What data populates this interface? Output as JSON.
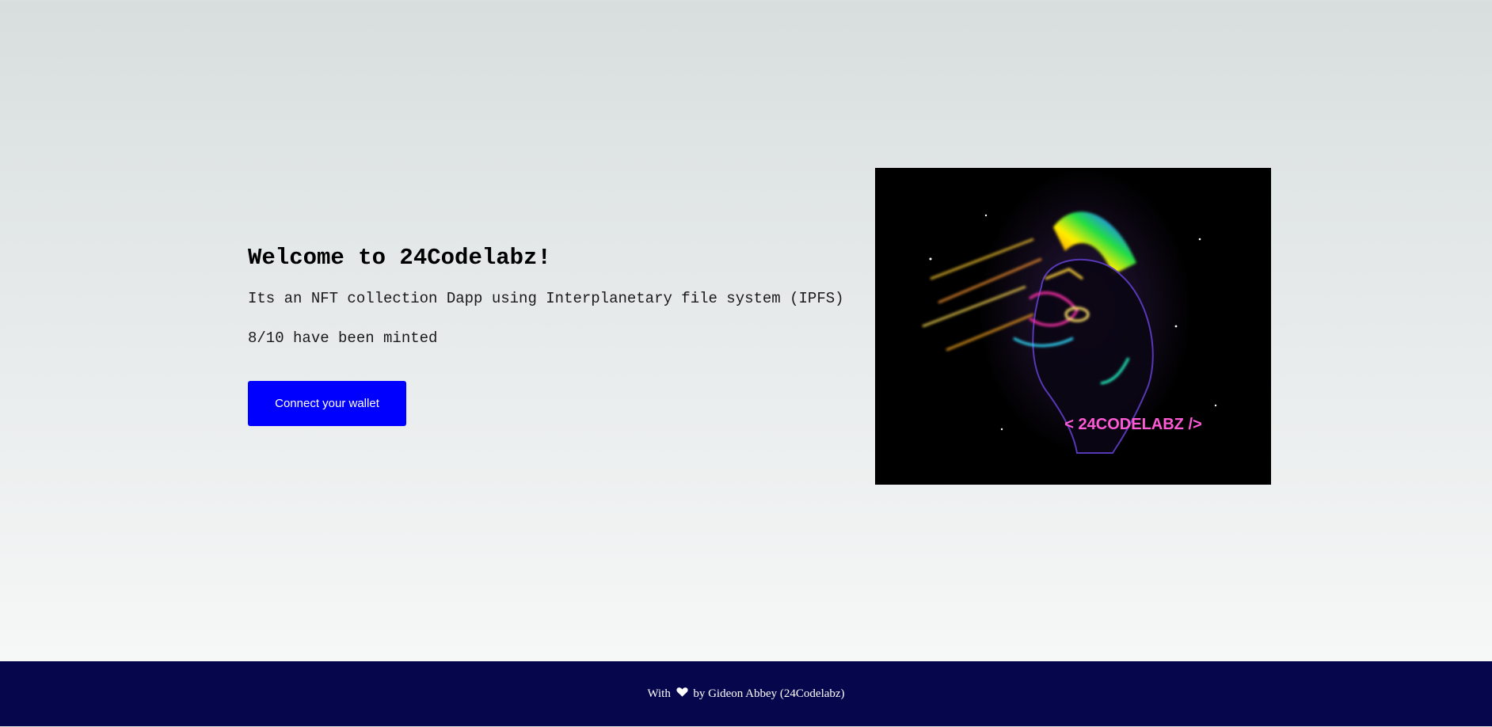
{
  "hero": {
    "title": "Welcome to 24Codelabz!",
    "description": "Its an NFT collection Dapp using Interplanetary file system (IPFS)",
    "minted_status": "8/10 have been minted",
    "connect_button_label": "Connect your wallet"
  },
  "artwork": {
    "label": "< 24CODELABZ />",
    "icon": "nft-artwork-image"
  },
  "footer": {
    "prefix": "With",
    "icon": "heart-icon",
    "suffix": "by Gideon Abbey (24Codelabz)"
  },
  "colors": {
    "accent": "#0000ff",
    "footer_bg": "#06064c",
    "neon_label": "#ff5ad6"
  }
}
